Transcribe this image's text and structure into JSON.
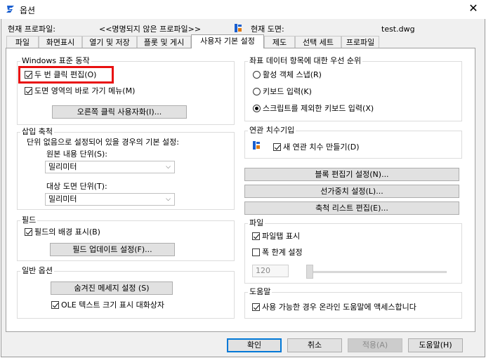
{
  "window": {
    "title": "옵션",
    "current_profile_label": "현재 프로파일:",
    "current_profile_value": "<<명명되지 않은 프로파일>>",
    "current_drawing_label": "현재 도면:",
    "current_drawing_value": "test.dwg"
  },
  "tabs": [
    {
      "label": "파일"
    },
    {
      "label": "화면표시"
    },
    {
      "label": "열기 및 저장"
    },
    {
      "label": "플롯 및 게시"
    },
    {
      "label": "사용자 기본 설정"
    },
    {
      "label": "제도"
    },
    {
      "label": "선택 세트"
    },
    {
      "label": "프로파일"
    }
  ],
  "windows_behavior": {
    "title": "Windows 표준 동작",
    "double_click_edit": "두 번 클릭 편집(O)",
    "shortcut_menus": "도면 영역의 바로 가기 메뉴(M)",
    "right_click_button": "오른쪽 클릭 사용자화(I)..."
  },
  "insert_scale": {
    "title": "삽입 축척",
    "description": "단위 없음으로 설정되어 있을 경우의 기본 설정:",
    "source_label": "원본 내용 단위(S):",
    "source_value": "밀리미터",
    "target_label": "대상 도면 단위(T):",
    "target_value": "밀리미터"
  },
  "fields": {
    "title": "필드",
    "background": "필드의 배경 표시(B)",
    "update_button": "필드 업데이트 설정(F)..."
  },
  "general": {
    "title": "일반 옵션",
    "hidden_messages_button": "숨겨진 메세지 설정 (S)",
    "ole_dialog": "OLE 텍스트 크기 표시 대화상자"
  },
  "priority": {
    "title": "좌표 데이터 항목에 대한 우선 순위",
    "osnap": "활성 객체 스냅(R)",
    "keyboard": "키보드 입력(K)",
    "keyboard_except_scripts": "스크립트를 제외한 키보드 입력(X)"
  },
  "assoc_dim": {
    "title": "연관 치수기입",
    "make_new": "새 연관 치수 만들기(D)"
  },
  "right_buttons": {
    "block_editor": "블록 편집기 설정(N)...",
    "lineweight": "선가중치 설정(L)...",
    "scale_list": "축척 리스트 편집(E)..."
  },
  "file_group": {
    "title": "파일",
    "show_tabs": "파일탭 표시",
    "width_limit": "폭 한계 설정",
    "width_value": "120"
  },
  "help_group": {
    "title": "도움말",
    "online_help": "사용 가능한 경우 온라인 도움말에 액세스합니다"
  },
  "footer": {
    "ok": "확인",
    "cancel": "취소",
    "apply": "적용(A)",
    "help": "도움말(H)"
  },
  "colors": {
    "highlight": "#e81010",
    "default_button_border": "#0078d7",
    "app_icon": "#1a5fd0"
  }
}
